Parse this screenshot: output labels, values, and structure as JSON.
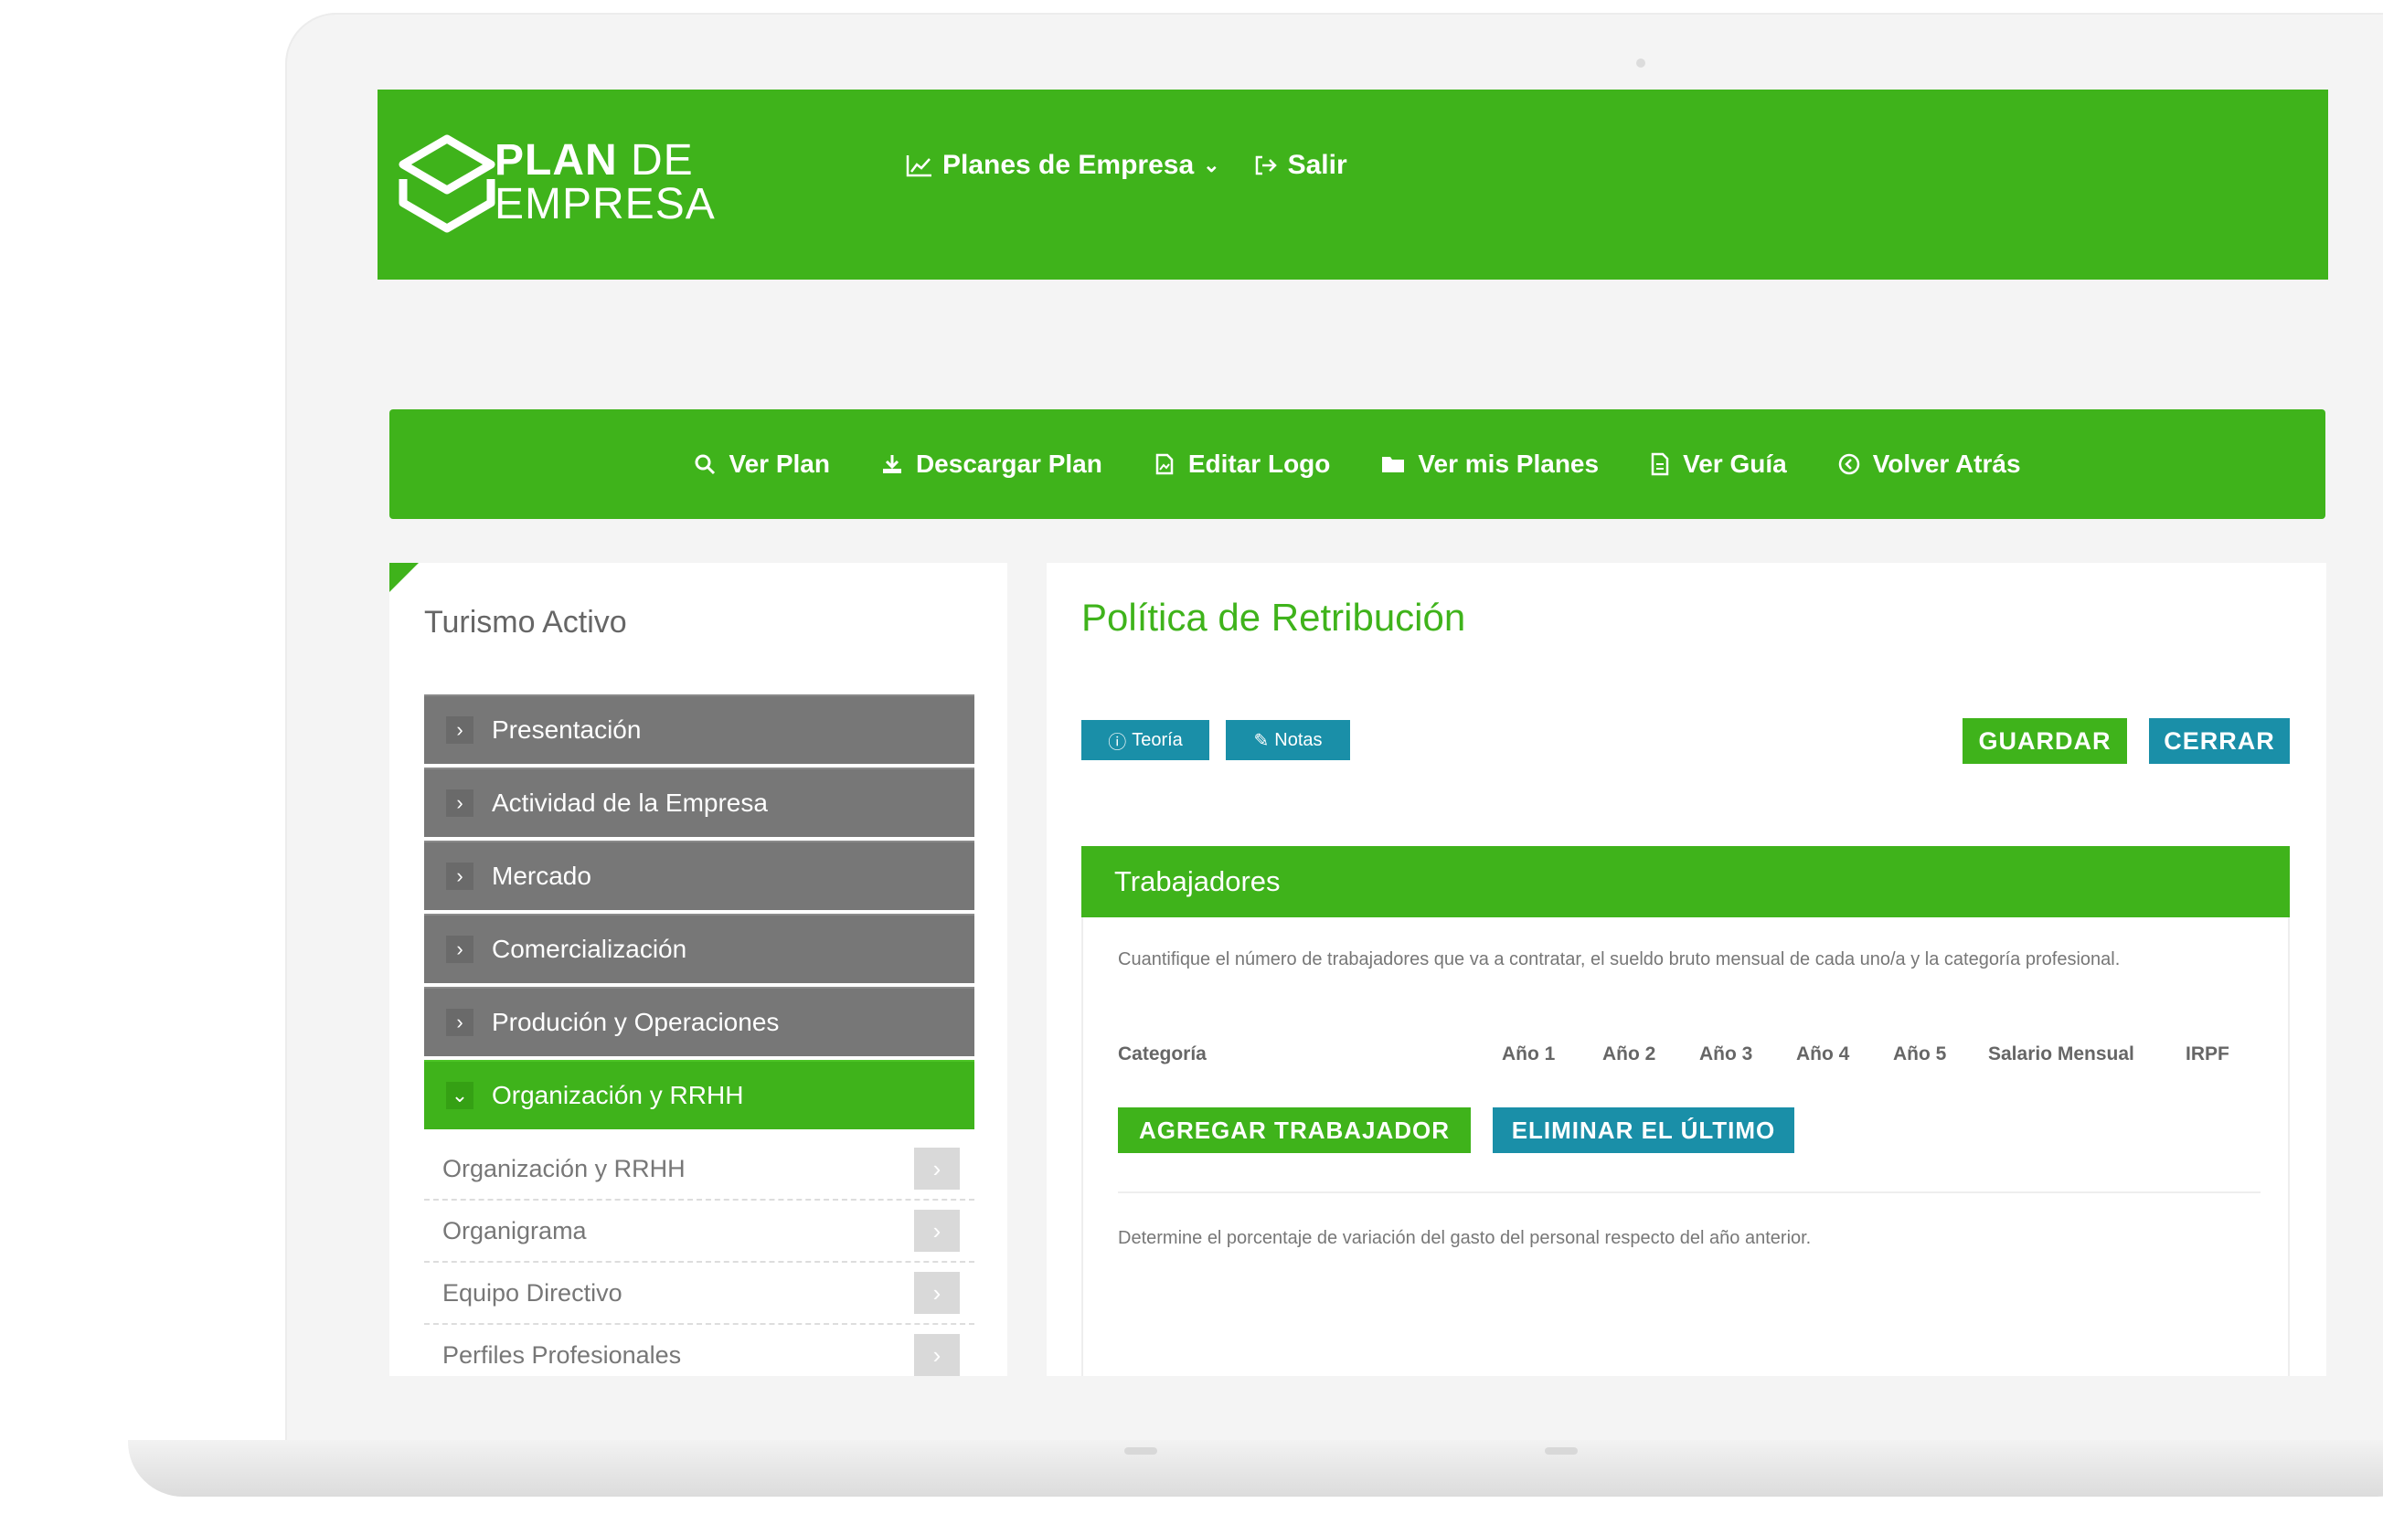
{
  "brand": {
    "line1_bold": "PLAN",
    "line1_light": "DE",
    "line2": "EMPRESA"
  },
  "topnav": {
    "plans_label": "Planes de Empresa",
    "logout_label": "Salir"
  },
  "actions": [
    {
      "label": "Ver Plan",
      "icon": "search-icon"
    },
    {
      "label": "Descargar Plan",
      "icon": "download-icon"
    },
    {
      "label": "Editar Logo",
      "icon": "image-icon"
    },
    {
      "label": "Ver mis Planes",
      "icon": "folder-icon"
    },
    {
      "label": "Ver Guía",
      "icon": "file-icon"
    },
    {
      "label": "Volver Atrás",
      "icon": "back-circle-icon"
    }
  ],
  "sidebar": {
    "title": "Turismo Activo",
    "sections": [
      {
        "label": "Presentación",
        "active": false
      },
      {
        "label": "Actividad de la Empresa",
        "active": false
      },
      {
        "label": "Mercado",
        "active": false
      },
      {
        "label": "Comercialización",
        "active": false
      },
      {
        "label": "Produción y Operaciones",
        "active": false
      },
      {
        "label": "Organización y RRHH",
        "active": true
      }
    ],
    "subitems": [
      "Organización y RRHH",
      "Organigrama",
      "Equipo Directivo",
      "Perfiles Profesionales"
    ]
  },
  "main": {
    "title": "Política de Retribución",
    "teoria_label": "Teoría",
    "notas_label": "Notas",
    "guardar_label": "GUARDAR",
    "cerrar_label": "CERRAR",
    "section_title": "Trabajadores",
    "description": "Cuantifique el número de trabajadores que va a contratar, el sueldo bruto mensual de cada uno/a y la categoría profesional.",
    "columns": [
      "Categoría",
      "Año 1",
      "Año 2",
      "Año 3",
      "Año 4",
      "Año 5",
      "Salario Mensual",
      "IRPF"
    ],
    "add_worker_label": "AGREGAR TRABAJADOR",
    "remove_last_label": "ELIMINAR EL ÚLTIMO",
    "description2": "Determine el porcentaje de variación del gasto del personal respecto del año anterior."
  },
  "colors": {
    "green": "#3fb31b",
    "teal": "#1a8fa8",
    "menu_gray": "#777777"
  }
}
